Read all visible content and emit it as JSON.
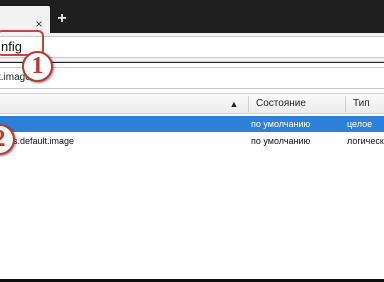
{
  "tab": {
    "close_glyph": "×",
    "new_tab_glyph": "+"
  },
  "url_bar": {
    "value": "nfig"
  },
  "search": {
    "value": "t.image"
  },
  "annotations": {
    "callout_1": "1",
    "callout_2": "2"
  },
  "table": {
    "sort_glyph": "▲",
    "columns": [
      "Состояние",
      "Тип"
    ],
    "rows": [
      {
        "name": "",
        "status": "по умолчанию",
        "type": "целое",
        "selected": true
      },
      {
        "name": "ns.default.image",
        "status": "по умолчанию",
        "type": "логическ",
        "selected": false
      }
    ]
  },
  "colors": {
    "selection": "#2f80d9",
    "callout_red": "#b83a34"
  }
}
